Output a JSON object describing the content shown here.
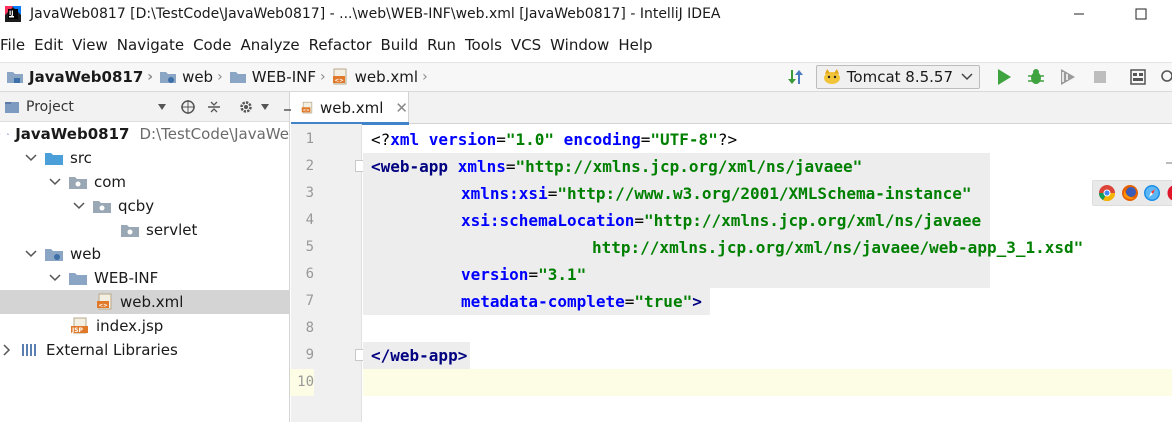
{
  "window": {
    "title": "JavaWeb0817 [D:\\TestCode\\JavaWeb0817] - ...\\web\\WEB-INF\\web.xml [JavaWeb0817] - IntelliJ IDEA",
    "controls": [
      "minimize-icon",
      "maximize-icon"
    ]
  },
  "menu": [
    "File",
    "Edit",
    "View",
    "Navigate",
    "Code",
    "Analyze",
    "Refactor",
    "Build",
    "Run",
    "Tools",
    "VCS",
    "Window",
    "Help"
  ],
  "breadcrumbs": [
    "JavaWeb0817",
    "web",
    "WEB-INF",
    "web.xml"
  ],
  "run_config": {
    "label": "Tomcat 8.5.57"
  },
  "project_panel": {
    "title": "Project",
    "tree": [
      {
        "label": "JavaWeb0817",
        "path": "D:\\TestCode\\JavaWe",
        "level": 0,
        "expanded": true,
        "icon": "module-folder-icon",
        "bold": true
      },
      {
        "label": "src",
        "level": 1,
        "expanded": true,
        "icon": "source-folder-icon"
      },
      {
        "label": "com",
        "level": 2,
        "expanded": true,
        "icon": "package-icon"
      },
      {
        "label": "qcby",
        "level": 3,
        "expanded": true,
        "icon": "package-icon"
      },
      {
        "label": "servlet",
        "level": 4,
        "icon": "package-icon"
      },
      {
        "label": "web",
        "level": 1,
        "expanded": true,
        "icon": "web-folder-icon"
      },
      {
        "label": "WEB-INF",
        "level": 2,
        "expanded": true,
        "icon": "folder-icon"
      },
      {
        "label": "web.xml",
        "level": 3,
        "icon": "xml-file-icon",
        "selected": true
      },
      {
        "label": "index.jsp",
        "level": 2,
        "icon": "jsp-file-icon"
      },
      {
        "label": "External Libraries",
        "level": 0,
        "expanded": false,
        "icon": "libraries-icon"
      }
    ]
  },
  "editor": {
    "tab_label": "web.xml",
    "line_numbers": [
      "1",
      "2",
      "3",
      "4",
      "5",
      "6",
      "7",
      "8",
      "9",
      "10"
    ],
    "code": {
      "l1": [
        "<?",
        "xml version",
        "=",
        "\"1.0\"",
        " encoding",
        "=",
        "\"UTF-8\"",
        "?>"
      ],
      "l2": [
        "<web-app ",
        "xmlns",
        "=",
        "\"http://xmlns.jcp.org/xml/ns/javaee\""
      ],
      "l3": [
        "xmlns:xsi",
        "=",
        "\"http://www.w3.org/2001/XMLSchema-instance\""
      ],
      "l4": [
        "xsi:schemaLocation",
        "=",
        "\"http://xmlns.jcp.org/xml/ns/javaee"
      ],
      "l5": [
        "http://xmlns.jcp.org/xml/ns/javaee/web-app_3_1.xsd\""
      ],
      "l6": [
        "version",
        "=",
        "\"3.1\""
      ],
      "l7": [
        "metadata-complete",
        "=",
        "\"true\"",
        ">"
      ],
      "l9": [
        "</web-app>"
      ]
    }
  },
  "colors": {
    "tag": "#000080",
    "attr": "#0000ff",
    "value": "#008000",
    "accent": "#4083c9"
  }
}
